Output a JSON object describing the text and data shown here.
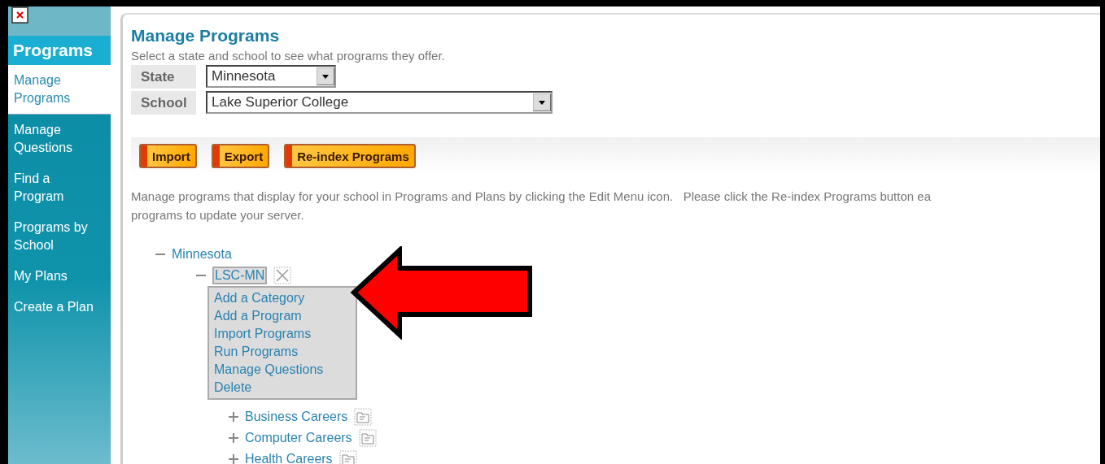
{
  "sidebar": {
    "title": "Programs",
    "items": [
      {
        "label": "Manage Programs",
        "selected": true
      },
      {
        "label": "Manage Questions",
        "selected": false
      },
      {
        "label": "Find a Program",
        "selected": false
      },
      {
        "label": "Programs by School",
        "selected": false
      },
      {
        "label": "My Plans",
        "selected": false
      },
      {
        "label": "Create a Plan",
        "selected": false
      }
    ]
  },
  "page": {
    "title": "Manage Programs",
    "subtitle": "Select a state and school to see what programs they offer.",
    "form": [
      {
        "label": "State",
        "value": "Minnesota",
        "kind": "short"
      },
      {
        "label": "School",
        "value": "Lake Superior College",
        "kind": "wide"
      }
    ],
    "toolbar": [
      "Import",
      "Export",
      "Re-index Programs"
    ],
    "description": [
      "Manage programs that display for your school in Programs and Plans by clicking the Edit Menu icon.   Please click the Re-index Programs button ea",
      "programs to update your server."
    ]
  },
  "tree": [
    {
      "label": "Minnesota",
      "expanded": true,
      "children": [
        {
          "label": "LSC-MN",
          "kind": "school",
          "expanded": true,
          "menu": [
            "Add a Category",
            "Add a Program",
            "Import Programs",
            "Run Programs",
            "Manage Questions",
            "Delete"
          ],
          "children": [
            {
              "label": "Business Careers",
              "kind": "category",
              "expanded": false
            },
            {
              "label": "Computer Careers",
              "kind": "category",
              "expanded": false
            },
            {
              "label": "Health Careers",
              "kind": "category",
              "expanded": false
            }
          ]
        }
      ]
    }
  ]
}
